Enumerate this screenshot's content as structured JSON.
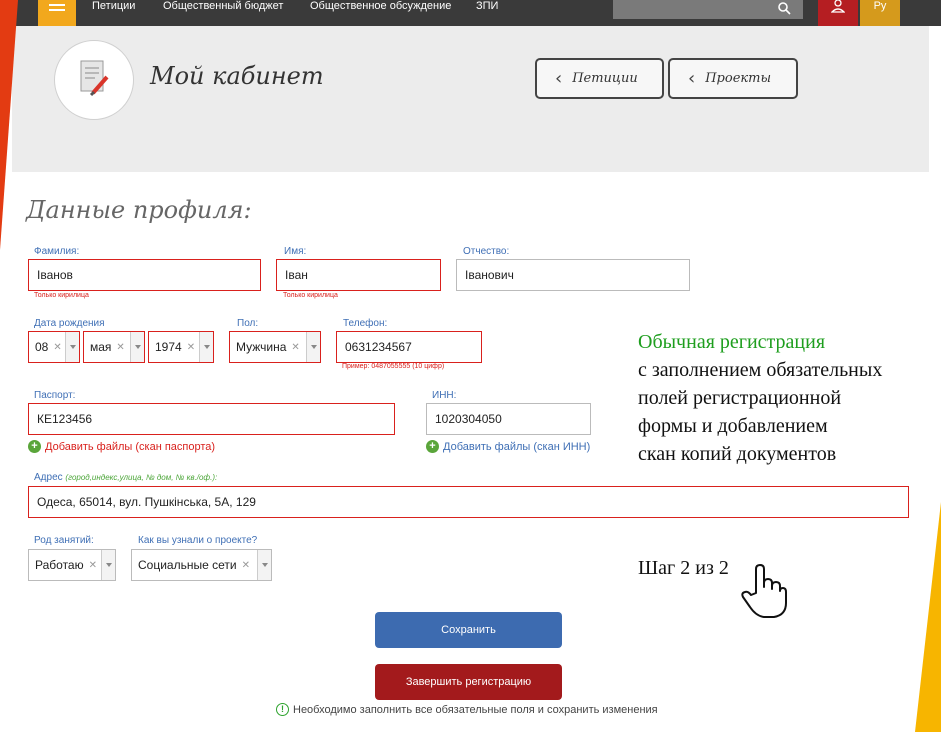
{
  "nav": {
    "links": [
      "Петиции",
      "Общественный бюджет",
      "Общественное обсуждение",
      "ЗПИ"
    ],
    "lang": "Ру",
    "icons": [
      "menu-icon",
      "search-icon",
      "user-icon"
    ]
  },
  "header": {
    "title": "Мой кабинет",
    "buttons": [
      "Петиции",
      "Проекты"
    ]
  },
  "section_title": "Данные профиля:",
  "form": {
    "surname": {
      "label": "Фамилия:",
      "value": "Іванов",
      "hint": "Только кирилица"
    },
    "name": {
      "label": "Имя:",
      "value": "Іван",
      "hint": "Только кирилица"
    },
    "patronymic": {
      "label": "Отчество:",
      "value": "Іванович"
    },
    "birth": {
      "label": "Дата рождения",
      "day": "08",
      "month": "мая",
      "year": "1974"
    },
    "gender": {
      "label": "Пол:",
      "value": "Мужчина"
    },
    "phone": {
      "label": "Телефон:",
      "value": "0631234567",
      "hint": "Пример: 0487055555 (10 цифр)"
    },
    "passport": {
      "label": "Паспорт:",
      "value": "КЕ123456",
      "add": "Добавить файлы (скан паспорта)"
    },
    "inn": {
      "label": "ИНН:",
      "value": "1020304050",
      "add": "Добавить файлы (скан ИНН)"
    },
    "address": {
      "label": "Адрес",
      "label_hint": "(город,индекс,улица, № дом, № кв./оф.):",
      "value": "Одеса, 65014, вул. Пушкінська, 5А, 129"
    },
    "occupation": {
      "label": "Род занятий:",
      "value": "Работаю"
    },
    "source": {
      "label": "Как вы узнали о проекте?",
      "value": "Социальные сети"
    }
  },
  "annotation": {
    "line1": "Обычная регистрация",
    "line2": "с заполнением обязательных",
    "line3": "полей регистрационной",
    "line4": "формы и добавлением",
    "line5": "скан копий документов",
    "step": "Шаг 2 из 2"
  },
  "buttons": {
    "save": "Сохранить",
    "finish": "Завершить регистрацию"
  },
  "notice": "Необходимо заполнить все обязательные поля и сохранить изменения",
  "colors": {
    "accent_orange": "#e33b12",
    "accent_yellow": "#f7b500",
    "error": "#d9211d",
    "save": "#3d6bb0",
    "finish": "#a31a1c",
    "label": "#3f6fb5"
  }
}
